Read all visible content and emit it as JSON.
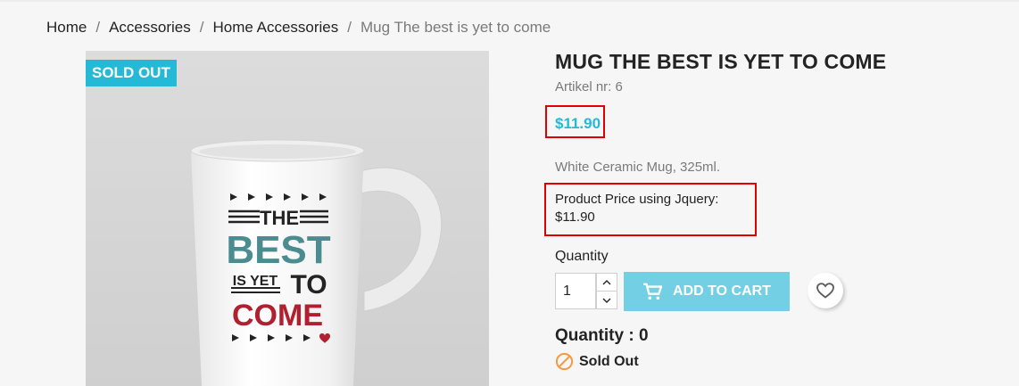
{
  "breadcrumb": {
    "items": [
      "Home",
      "Accessories",
      "Home Accessories"
    ],
    "separator": "/",
    "current": "Mug The best is yet to come"
  },
  "product": {
    "badge": "SOLD OUT",
    "image_text": {
      "line1": "THE",
      "line2": "BEST",
      "line3a": "IS YET",
      "line3b": "TO",
      "line4": "COME"
    },
    "title": "MUG THE BEST IS YET TO COME",
    "reference_label": "Artikel nr:",
    "reference_value": "6",
    "price": "$11.90",
    "short_description": "White Ceramic Mug, 325ml.",
    "jquery_price_label": "Product Price using Jquery:",
    "jquery_price_value": "$11.90"
  },
  "cart": {
    "quantity_label": "Quantity",
    "quantity_value": "1",
    "add_to_cart_label": "ADD TO CART"
  },
  "stock": {
    "quantity_text": "Quantity : 0",
    "status": "Sold Out"
  },
  "colors": {
    "accent": "#24b9d7",
    "highlight_border": "#e00000",
    "sold_out_icon": "#f39d48"
  },
  "icons": {
    "cart": "shopping-cart-icon",
    "wishlist": "heart-outline-icon",
    "stock": "block-icon"
  }
}
